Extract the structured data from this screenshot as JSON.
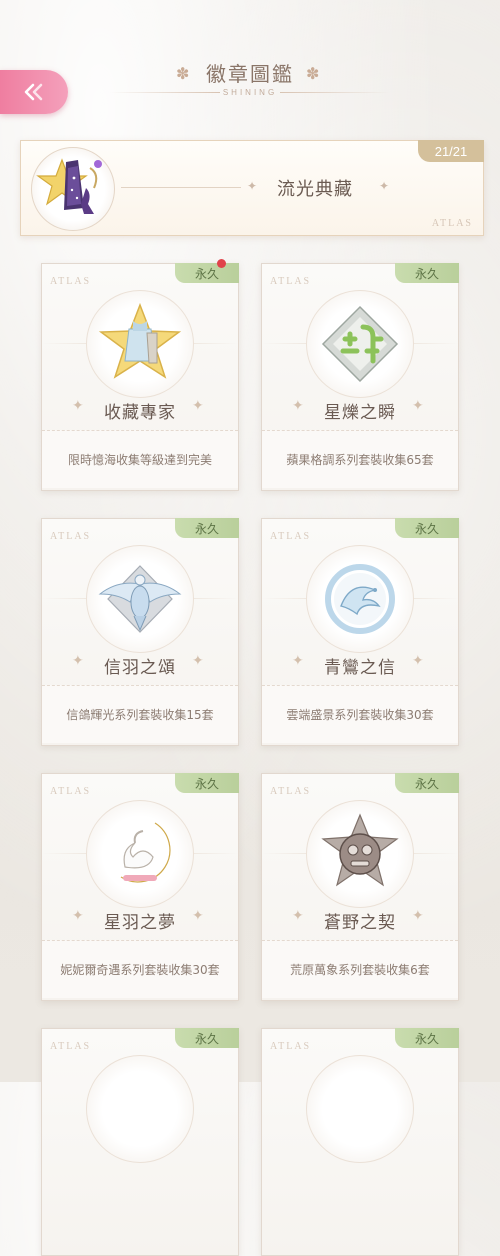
{
  "header": {
    "title": "徽章圖鑑",
    "subtitle": "SHINING"
  },
  "collection": {
    "count": "21/21",
    "name": "流光典藏",
    "atlas": "ATLAS"
  },
  "cards": [
    {
      "tag": "永久",
      "atlas": "ATLAS",
      "name": "收藏專家",
      "desc": "限時憶海收集等級達到完美",
      "new": true,
      "icon": "dress-star-badge"
    },
    {
      "tag": "永久",
      "atlas": "ATLAS",
      "name": "星爍之瞬",
      "desc": "蘋果格調系列套裝收集65套",
      "new": false,
      "icon": "sparkle-glyph-badge"
    },
    {
      "tag": "永久",
      "atlas": "ATLAS",
      "name": "信羽之頌",
      "desc": "信鴿輝光系列套裝收集15套",
      "new": false,
      "icon": "winged-bird-badge"
    },
    {
      "tag": "永久",
      "atlas": "ATLAS",
      "name": "青鸞之信",
      "desc": "雲端盛景系列套裝收集30套",
      "new": false,
      "icon": "phoenix-ring-badge"
    },
    {
      "tag": "永久",
      "atlas": "ATLAS",
      "name": "星羽之夢",
      "desc": "妮妮爾奇遇系列套裝收集30套",
      "new": false,
      "icon": "swan-moon-badge"
    },
    {
      "tag": "永久",
      "atlas": "ATLAS",
      "name": "蒼野之契",
      "desc": "荒原萬象系列套裝收集6套",
      "new": false,
      "icon": "tribal-mask-badge"
    },
    {
      "tag": "永久",
      "atlas": "ATLAS",
      "name": "",
      "desc": "",
      "new": false,
      "icon": "partial-badge"
    },
    {
      "tag": "永久",
      "atlas": "ATLAS",
      "name": "",
      "desc": "",
      "new": false,
      "icon": "partial-badge"
    }
  ]
}
